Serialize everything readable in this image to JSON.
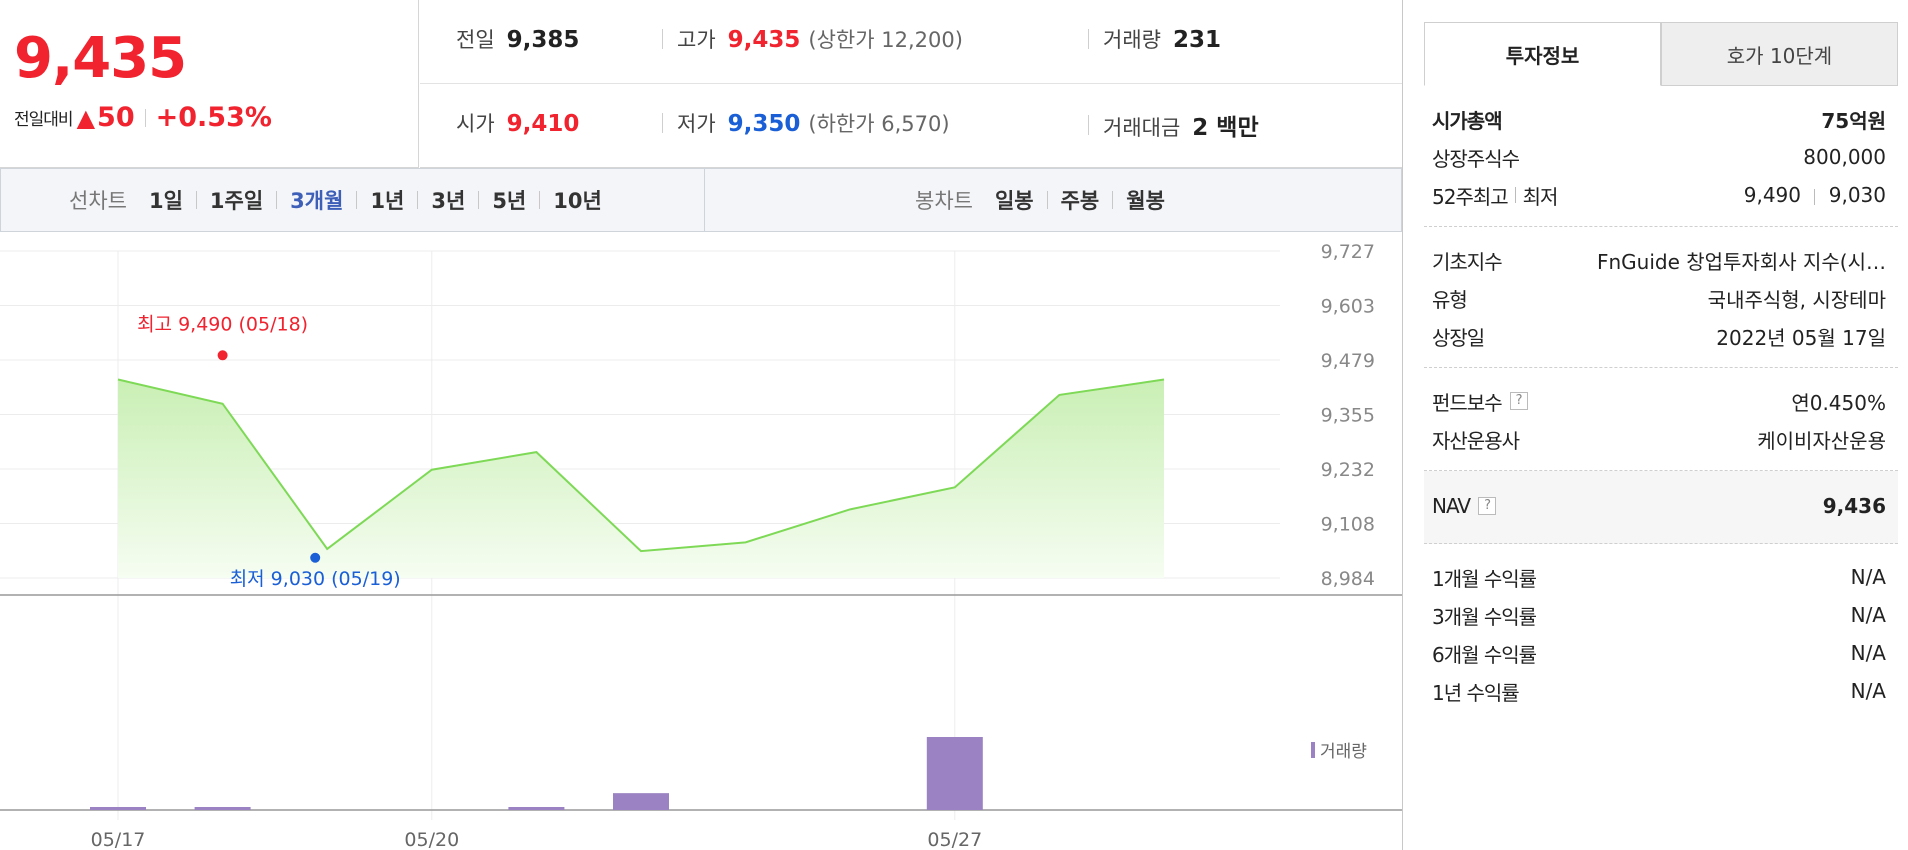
{
  "price": {
    "current": "9,435",
    "change_label": "전일대비",
    "change_arrow": "▲",
    "change_value": "50",
    "change_pct": "+0.53%"
  },
  "summary": {
    "row1": [
      {
        "label": "전일",
        "value": "9,385",
        "sub": ""
      },
      {
        "label": "고가",
        "value": "9,435",
        "sub": "(상한가 12,200)"
      },
      {
        "label": "거래량",
        "value": "231",
        "sub": ""
      }
    ],
    "row2": [
      {
        "label": "시가",
        "value": "9,410",
        "sub": ""
      },
      {
        "label": "저가",
        "value": "9,350",
        "sub": "(하한가 6,570)"
      },
      {
        "label": "거래대금",
        "value": "2 백만",
        "sub": ""
      }
    ]
  },
  "periods": {
    "line_title": "선차트",
    "line_items": [
      "1일",
      "1주일",
      "3개월",
      "1년",
      "3년",
      "5년",
      "10년"
    ],
    "line_active": "3개월",
    "candle_title": "봉차트",
    "candle_items": [
      "일봉",
      "주봉",
      "월봉"
    ]
  },
  "chart_data": {
    "type": "area",
    "x": [
      "05/17",
      "05/18",
      "05/19",
      "05/20",
      "05/23",
      "05/24",
      "05/25",
      "05/26",
      "05/27",
      "05/30",
      "05/31"
    ],
    "y": [
      9435,
      9380,
      9050,
      9230,
      9270,
      9045,
      9065,
      9140,
      9190,
      9400,
      9435
    ],
    "volume": [
      0.03,
      0.02,
      0,
      0,
      0.05,
      0.3,
      0,
      0,
      1.3,
      0,
      0
    ],
    "ylim": [
      8984,
      9727
    ],
    "yticks": [
      "9,727",
      "9,603",
      "9,479",
      "9,355",
      "9,232",
      "9,108",
      "8,984"
    ],
    "xticks": [
      "05/17",
      "05/20",
      "05/27"
    ],
    "annotations": {
      "high": {
        "label": "최고 9,490 (05/18)",
        "value": 9490
      },
      "low": {
        "label": "최저 9,030 (05/19)",
        "value": 9030
      }
    },
    "volume_legend": "거래량",
    "colors": {
      "line": "#7ed957",
      "fill_top": "#c9efb4",
      "fill_bottom": "#f6fdf2",
      "volume": "#9b82c2",
      "high": "#f0232f",
      "low": "#1a5fd6"
    }
  },
  "info": {
    "tabs": [
      "투자정보",
      "호가 10단계"
    ],
    "active_tab": "투자정보",
    "market": [
      {
        "k": "시가총액",
        "v": "75억원"
      },
      {
        "k": "상장주식수",
        "v": "800,000"
      },
      {
        "k": "52주최고",
        "k2": "최저",
        "v": "9,490",
        "v2": "9,030"
      }
    ],
    "fund": [
      {
        "k": "기초지수",
        "v": "FnGuide 창업투자회사 지수(시…"
      },
      {
        "k": "유형",
        "v": "국내주식형, 시장테마"
      },
      {
        "k": "상장일",
        "v": "2022년 05월 17일"
      }
    ],
    "fee": [
      {
        "k": "펀드보수",
        "v": "연0.450%"
      },
      {
        "k": "자산운용사",
        "v": "케이비자산운용"
      }
    ],
    "nav": {
      "k": "NAV",
      "v": "9,436"
    },
    "returns": [
      {
        "k": "1개월 수익률",
        "v": "N/A"
      },
      {
        "k": "3개월 수익률",
        "v": "N/A"
      },
      {
        "k": "6개월 수익률",
        "v": "N/A"
      },
      {
        "k": "1년 수익률",
        "v": "N/A"
      }
    ],
    "help_icon": "?"
  }
}
